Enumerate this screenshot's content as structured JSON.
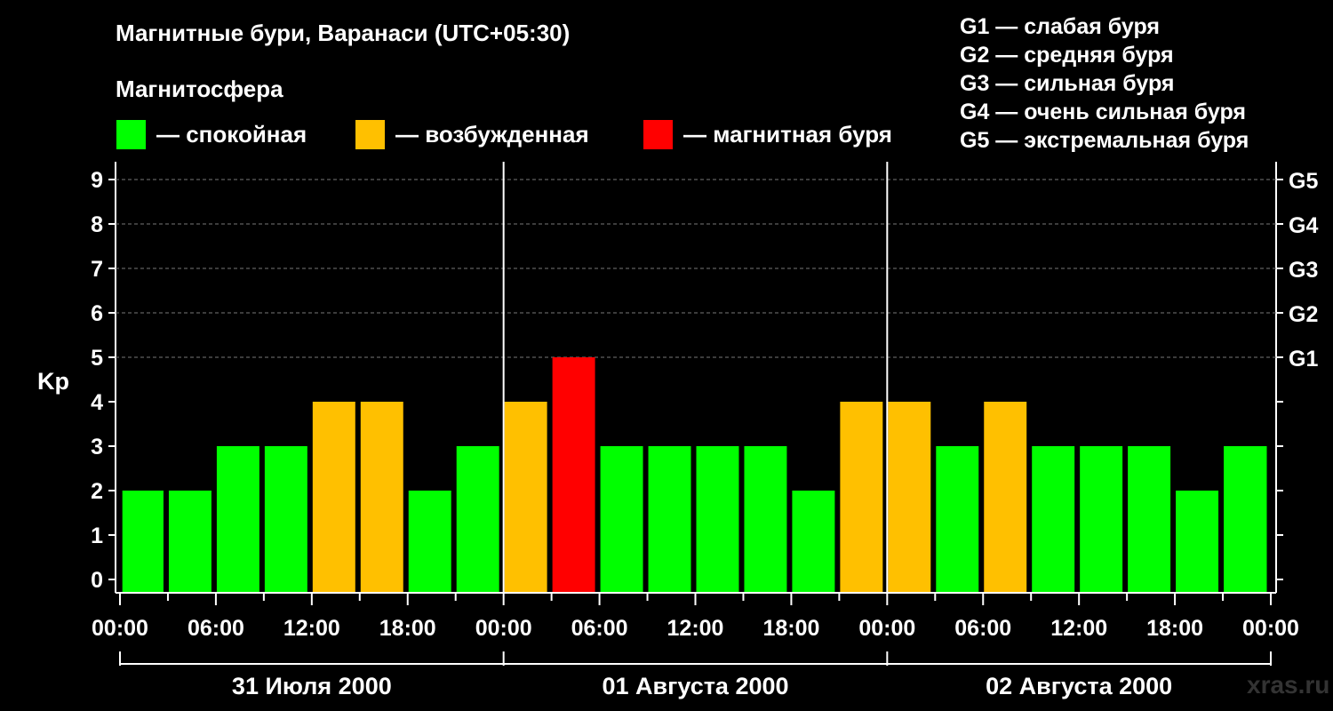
{
  "header": {
    "title": "Магнитные бури, Варанаси (UTC+05:30)",
    "subtitle": "Магнитосфера"
  },
  "legend": [
    {
      "label": "— спокойная",
      "color": "#00ff00"
    },
    {
      "label": "— возбужденная",
      "color": "#ffc000"
    },
    {
      "label": "— магнитная буря",
      "color": "#ff0000"
    }
  ],
  "g_legend": [
    "G1 — слабая буря",
    "G2 — средняя буря",
    "G3 — сильная буря",
    "G4 — очень сильная буря",
    "G5 — экстремальная буря"
  ],
  "watermark": "xras.ru",
  "chart_data": {
    "type": "bar",
    "ylabel": "Kp",
    "ylim": [
      0,
      9
    ],
    "yticks": [
      "0",
      "1",
      "2",
      "3",
      "4",
      "5",
      "6",
      "7",
      "8",
      "9"
    ],
    "g_scale": [
      {
        "kp": 5,
        "label": "G1"
      },
      {
        "kp": 6,
        "label": "G2"
      },
      {
        "kp": 7,
        "label": "G3"
      },
      {
        "kp": 8,
        "label": "G4"
      },
      {
        "kp": 9,
        "label": "G5"
      }
    ],
    "x_tick_labels": [
      "00:00",
      "06:00",
      "12:00",
      "18:00",
      "00:00",
      "06:00",
      "12:00",
      "18:00",
      "00:00",
      "06:00",
      "12:00",
      "18:00",
      "00:00"
    ],
    "days": [
      "31 Июля 2000",
      "01 Августа 2000",
      "02 Августа 2000"
    ],
    "x_range_hours": [
      0,
      72
    ],
    "interval_hours": 3,
    "values": [
      2,
      2,
      3,
      3,
      4,
      4,
      2,
      3,
      4,
      5,
      3,
      3,
      3,
      3,
      2,
      4,
      4,
      3,
      4,
      3,
      3,
      3,
      2,
      3
    ],
    "colors": {
      "quiet": "#00ff00",
      "active": "#ffc000",
      "storm": "#ff0000"
    },
    "grid": true
  }
}
